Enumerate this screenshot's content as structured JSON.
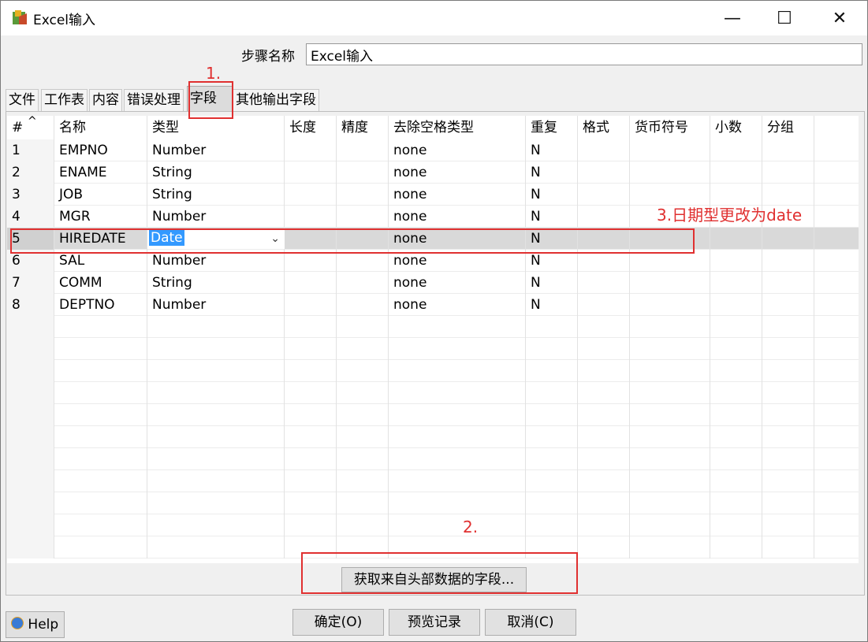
{
  "window": {
    "title": "Excel输入",
    "minimize": "—",
    "maximize": "☐",
    "close": "✕"
  },
  "step": {
    "label": "步骤名称",
    "value": "Excel输入"
  },
  "tabs": [
    {
      "label": "文件"
    },
    {
      "label": "工作表"
    },
    {
      "label": "内容"
    },
    {
      "label": "错误处理"
    },
    {
      "label": "字段",
      "active": true
    },
    {
      "label": "其他输出字段"
    }
  ],
  "table": {
    "sort_indicator": "^",
    "columns": [
      "#",
      "名称",
      "类型",
      "长度",
      "精度",
      "去除空格类型",
      "重复",
      "格式",
      "货币符号",
      "小数",
      "分组"
    ],
    "rows": [
      [
        "1",
        "EMPNO",
        "Number",
        "",
        "",
        "none",
        "N",
        "",
        "",
        "",
        ""
      ],
      [
        "2",
        "ENAME",
        "String",
        "",
        "",
        "none",
        "N",
        "",
        "",
        "",
        ""
      ],
      [
        "3",
        "JOB",
        "String",
        "",
        "",
        "none",
        "N",
        "",
        "",
        "",
        ""
      ],
      [
        "4",
        "MGR",
        "Number",
        "",
        "",
        "none",
        "N",
        "",
        "",
        "",
        ""
      ],
      [
        "5",
        "HIREDATE",
        "Date",
        "",
        "",
        "none",
        "N",
        "",
        "",
        "",
        ""
      ],
      [
        "6",
        "SAL",
        "Number",
        "",
        "",
        "none",
        "N",
        "",
        "",
        "",
        ""
      ],
      [
        "7",
        "COMM",
        "String",
        "",
        "",
        "none",
        "N",
        "",
        "",
        "",
        ""
      ],
      [
        "8",
        "DEPTNO",
        "Number",
        "",
        "",
        "none",
        "N",
        "",
        "",
        "",
        ""
      ]
    ],
    "selected_row": 4,
    "empty_rows": 11
  },
  "buttons": {
    "get_fields": "获取来自头部数据的字段...",
    "ok": "确定(O)",
    "preview": "预览记录",
    "cancel": "取消(C)",
    "help": "Help"
  },
  "annotations": {
    "a1": "1.",
    "a2": "2.",
    "a3": "3.日期型更改为date",
    "color": "#e03030"
  }
}
